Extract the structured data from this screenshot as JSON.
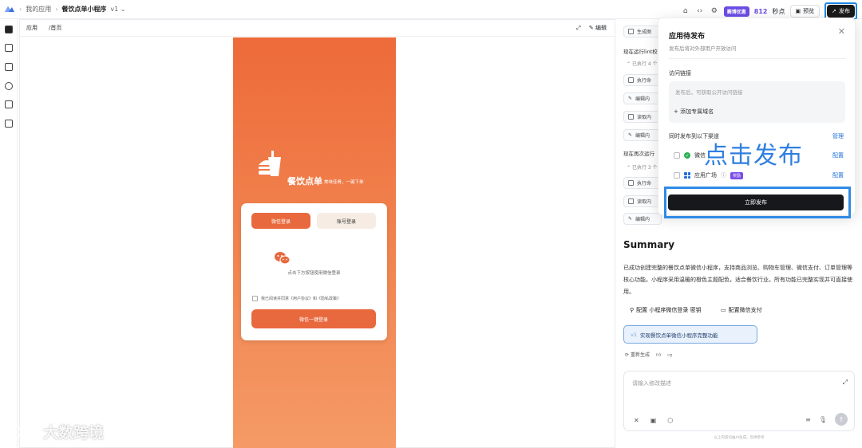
{
  "topbar": {
    "breadcrumb": [
      "我的应用",
      "餐饮点单小程序"
    ],
    "version": "v1",
    "vip_badge": "赛博优惠",
    "points_value": "812",
    "points_unit": "秒点",
    "preview_label": "预览",
    "publish_label": "发布"
  },
  "preview": {
    "tab_label": "应用",
    "path": "/首页",
    "edit_label": "编辑",
    "phone": {
      "app_title": "餐饮点单",
      "app_sub": "美味佳肴，一键下单",
      "tab_wechat": "微信登录",
      "tab_account": "账号登录",
      "scan_tip": "点击下方按钮使用微信登录",
      "agree_text": "我已阅读并同意《用户协议》和《隐私政策》",
      "wechat_button": "微信一键登录"
    }
  },
  "right": {
    "chip_top": "生成图",
    "running_1": "现在运行lint校",
    "executed_1": "已执行 4 个",
    "chips_1": [
      "执行命",
      "编辑内",
      "读取内",
      "编辑内"
    ],
    "running_2": "现在再次运行",
    "executed_2": "已执行 3 个",
    "chips_2": [
      "执行命",
      "读取内",
      "编辑内"
    ],
    "summary_title": "Summary",
    "summary_text": "已成功创建完整的餐饮点单微信小程序，支持商品浏览、购物车管理、微信支付、订单管理等核心功能。小程序采用温暖的橙色主题配色，适合餐饮行业。所有功能已完整实现并可直接使用。",
    "config_1": "配置 小程序微信登录 密钥",
    "config_2": "配置微信支付",
    "implement_label": "实现餐饮点单微信小程序完整功能",
    "regen_label": "重新生成",
    "input_placeholder": "请输入修改描述",
    "disclaimer": "以上内容均由AI生成，仅供参考"
  },
  "popup": {
    "title": "应用待发布",
    "subtitle": "发布后将对外部用户开放访问",
    "access_label": "访问链接",
    "url_hint": "发布后，可获取公开访问链接",
    "add_domain": "添加专属域名",
    "channels_label": "同时发布到以下渠道",
    "manage": "管理",
    "channel_1": "微信",
    "channel_2": "应用广场",
    "new_tag": "奖励",
    "config_link": "配置",
    "publish_now": "立即发布"
  },
  "overlay": {
    "instruction": "点击发布"
  },
  "watermark": {
    "text": "大数跨境"
  },
  "colors": {
    "accent_orange": "#e8693e",
    "accent_blue": "#2f7fe0",
    "vip_purple": "#6b4ce6",
    "dark_button": "#16181c"
  }
}
